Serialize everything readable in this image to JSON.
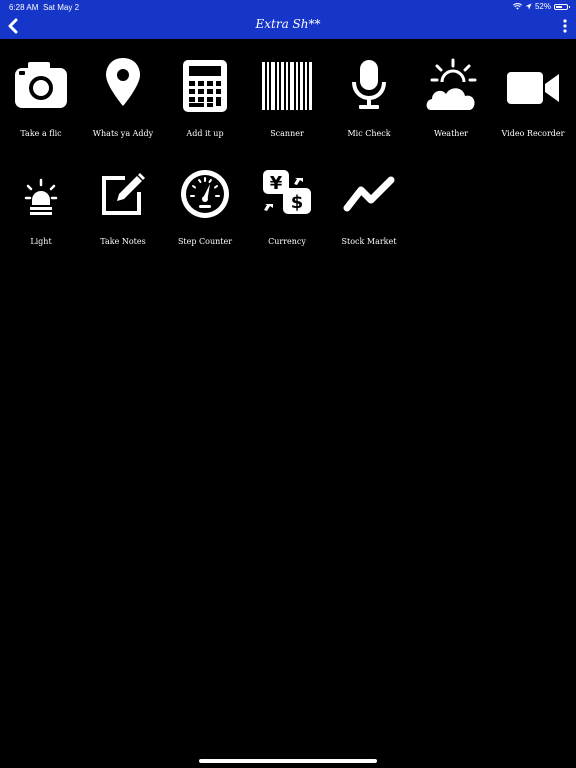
{
  "status": {
    "time": "6:28 AM",
    "date": "Sat May 2",
    "battery": "52%"
  },
  "nav": {
    "title": "Extra Sh**"
  },
  "colors": {
    "header": "#1536c9",
    "background": "#000000",
    "icon": "#ffffff"
  },
  "tiles": [
    {
      "label": "Take a flic",
      "icon": "camera-icon"
    },
    {
      "label": "Whats ya Addy",
      "icon": "map-pin-icon"
    },
    {
      "label": "Add it up",
      "icon": "calculator-icon"
    },
    {
      "label": "Scanner",
      "icon": "barcode-icon"
    },
    {
      "label": "Mic Check",
      "icon": "microphone-icon"
    },
    {
      "label": "Weather",
      "icon": "weather-icon"
    },
    {
      "label": "Video Recorder",
      "icon": "video-camera-icon"
    },
    {
      "label": "Light",
      "icon": "light-icon"
    },
    {
      "label": "Take Notes",
      "icon": "notes-icon"
    },
    {
      "label": "Step Counter",
      "icon": "gauge-icon"
    },
    {
      "label": "Currency",
      "icon": "currency-icon"
    },
    {
      "label": "Stock Market",
      "icon": "stock-chart-icon"
    }
  ]
}
